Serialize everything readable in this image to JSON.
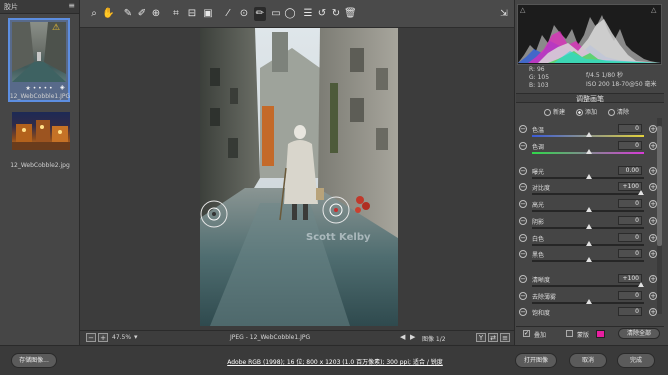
{
  "filmstrip": {
    "title": "胶片",
    "items": [
      {
        "name": "12_WebCobble1.JPG",
        "rating": "★ • • • •"
      },
      {
        "name": "12_WebCobble2.jpg"
      }
    ]
  },
  "toolbar": {
    "tools": [
      "zoom-icon",
      "hand-icon",
      "white-balance-icon",
      "color-sampler-icon",
      "targeted-adjustment-icon",
      "crop-icon",
      "straighten-icon",
      "transform-icon",
      "spot-removal-icon",
      "red-eye-icon",
      "adjustment-brush-icon",
      "graduated-filter-icon",
      "radial-filter-icon",
      "preferences-icon",
      "rotate-ccw-icon",
      "rotate-cw-icon",
      "trash-icon"
    ],
    "fullscreen_icon": "fullscreen-icon"
  },
  "photo": {
    "watermark": "Scott Kelby"
  },
  "image_bar": {
    "zoom": "47.5%",
    "filename": "JPEG - 12_WebCobble1.JPG",
    "page": "图像 1/2"
  },
  "camera_info": {
    "r_label": "R:",
    "r_value": "96",
    "g_label": "G:",
    "g_value": "105",
    "b_label": "B:",
    "b_value": "103",
    "aperture_shutter": "f/4.5   1/80 秒",
    "iso_lens": "ISO 200   18-70@50 毫米"
  },
  "adjust_panel": {
    "title": "调整画笔",
    "modes": [
      "新建",
      "添加",
      "清除"
    ],
    "selected_mode": "添加",
    "sliders": [
      {
        "label": "色温",
        "value": "0"
      },
      {
        "label": "色调",
        "value": "0"
      },
      {
        "label": "曝光",
        "value": "0.00"
      },
      {
        "label": "对比度",
        "value": "+100"
      },
      {
        "label": "高光",
        "value": "0"
      },
      {
        "label": "阴影",
        "value": "0"
      },
      {
        "label": "白色",
        "value": "0"
      },
      {
        "label": "黑色",
        "value": "0"
      },
      {
        "label": "清晰度",
        "value": "+100"
      },
      {
        "label": "去除薄雾",
        "value": "0"
      },
      {
        "label": "饱和度",
        "value": "0"
      }
    ],
    "overlay_label": "叠加",
    "mask_label": "蒙版",
    "mask_color": "#e81ea0",
    "clear_all": "清除全部"
  },
  "bottom": {
    "save_image": "存储图像...",
    "workflow_options": "Adobe RGB (1998); 16 位; 800 x 1203 (1.0 百万像素); 300 ppi; 适合 / 锐度",
    "open_image": "打开图像",
    "cancel": "取消",
    "done": "完成"
  },
  "colors": {
    "accent": "#5d8ee0",
    "panel": "#454545",
    "canvas": "#3c3c3c"
  }
}
